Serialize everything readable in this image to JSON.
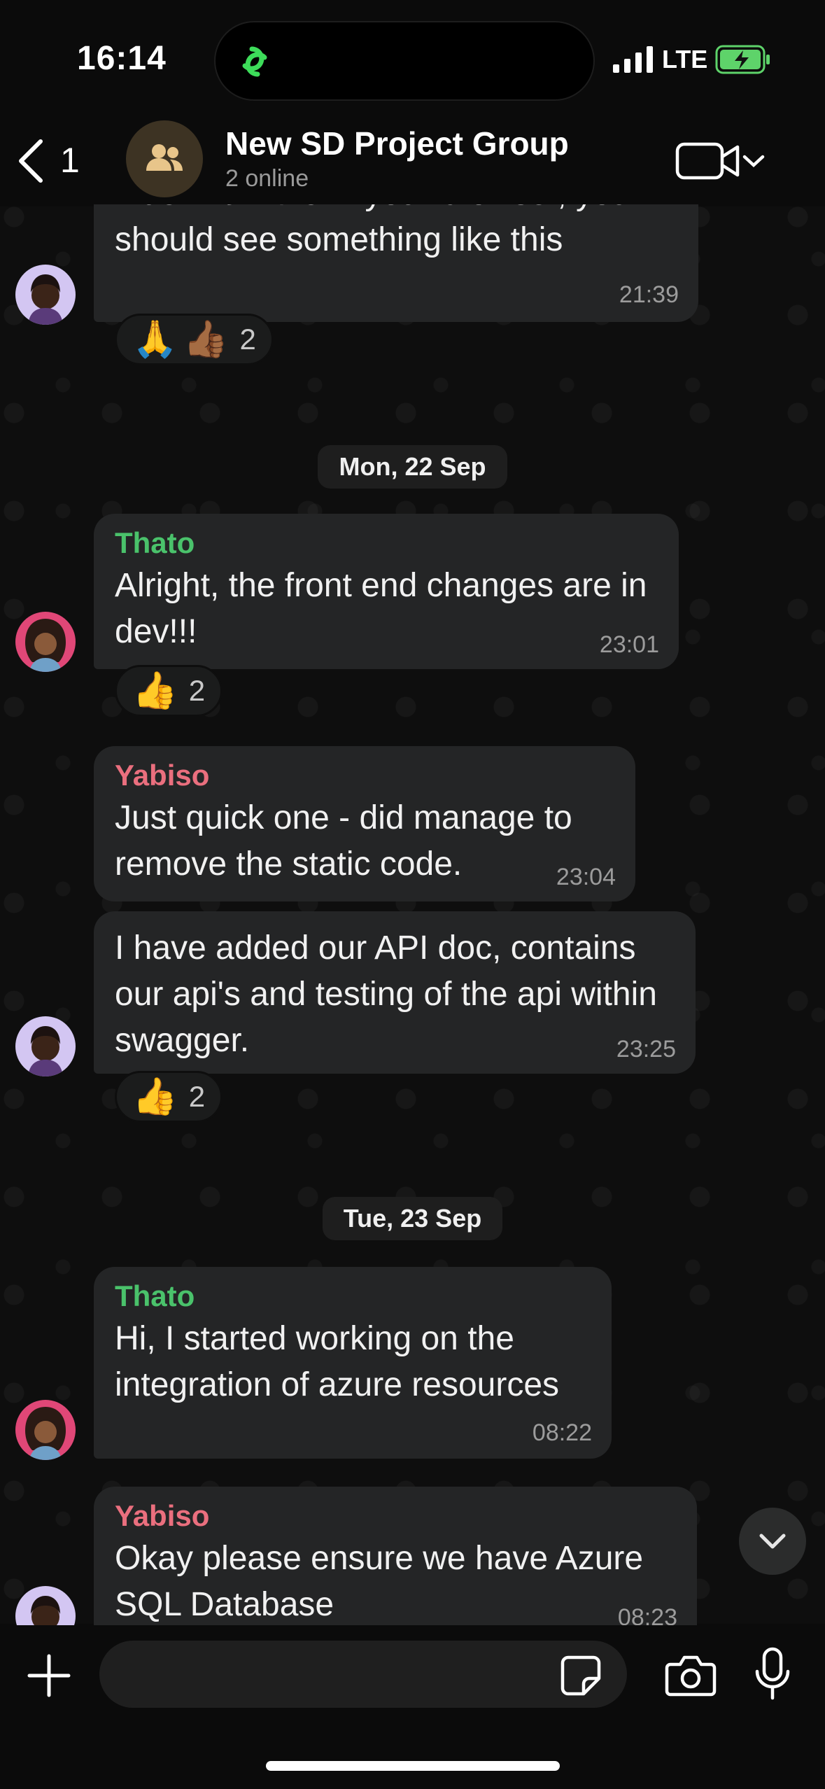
{
  "status": {
    "time": "16:14",
    "network": "LTE"
  },
  "header": {
    "back_count": "1",
    "title": "New SD Project Group",
    "subtitle": "2 online"
  },
  "messages": [
    {
      "text": "index.html file in your browser, you should see something like this",
      "time": "21:39",
      "reactions": [
        "🙏",
        "👍🏾"
      ],
      "reaction_count": "2"
    },
    {
      "date": "Mon, 22 Sep"
    },
    {
      "sender": "Thato",
      "text": "Alright, the front end changes are in dev!!!",
      "time": "23:01",
      "reactions": [
        "👍"
      ],
      "reaction_count": "2"
    },
    {
      "sender": "Yabiso",
      "text": "Just quick one - did manage to remove the static code.",
      "time": "23:04"
    },
    {
      "text": "I have added our API doc, contains our api's and testing of the api within swagger.",
      "time": "23:25",
      "reactions": [
        "👍"
      ],
      "reaction_count": "2"
    },
    {
      "date": "Tue, 23 Sep"
    },
    {
      "sender": "Thato",
      "text": "Hi, I started working on the integration of azure resources",
      "time": "08:22"
    },
    {
      "sender": "Yabiso",
      "text": "Okay please ensure we have Azure SQL Database",
      "time": "08:23"
    }
  ],
  "composer": {
    "placeholder": ""
  },
  "colors": {
    "thato": "#4ac26b",
    "yabiso": "#ea6f7e",
    "bubble": "#242526",
    "battery": "#5ed36a"
  },
  "icons": [
    "chat-link-icon",
    "signal-icon",
    "battery-charging-icon",
    "back-chevron-icon",
    "group-icon",
    "video-call-icon",
    "chevron-down-icon",
    "plus-icon",
    "sticker-icon",
    "camera-icon",
    "microphone-icon"
  ]
}
